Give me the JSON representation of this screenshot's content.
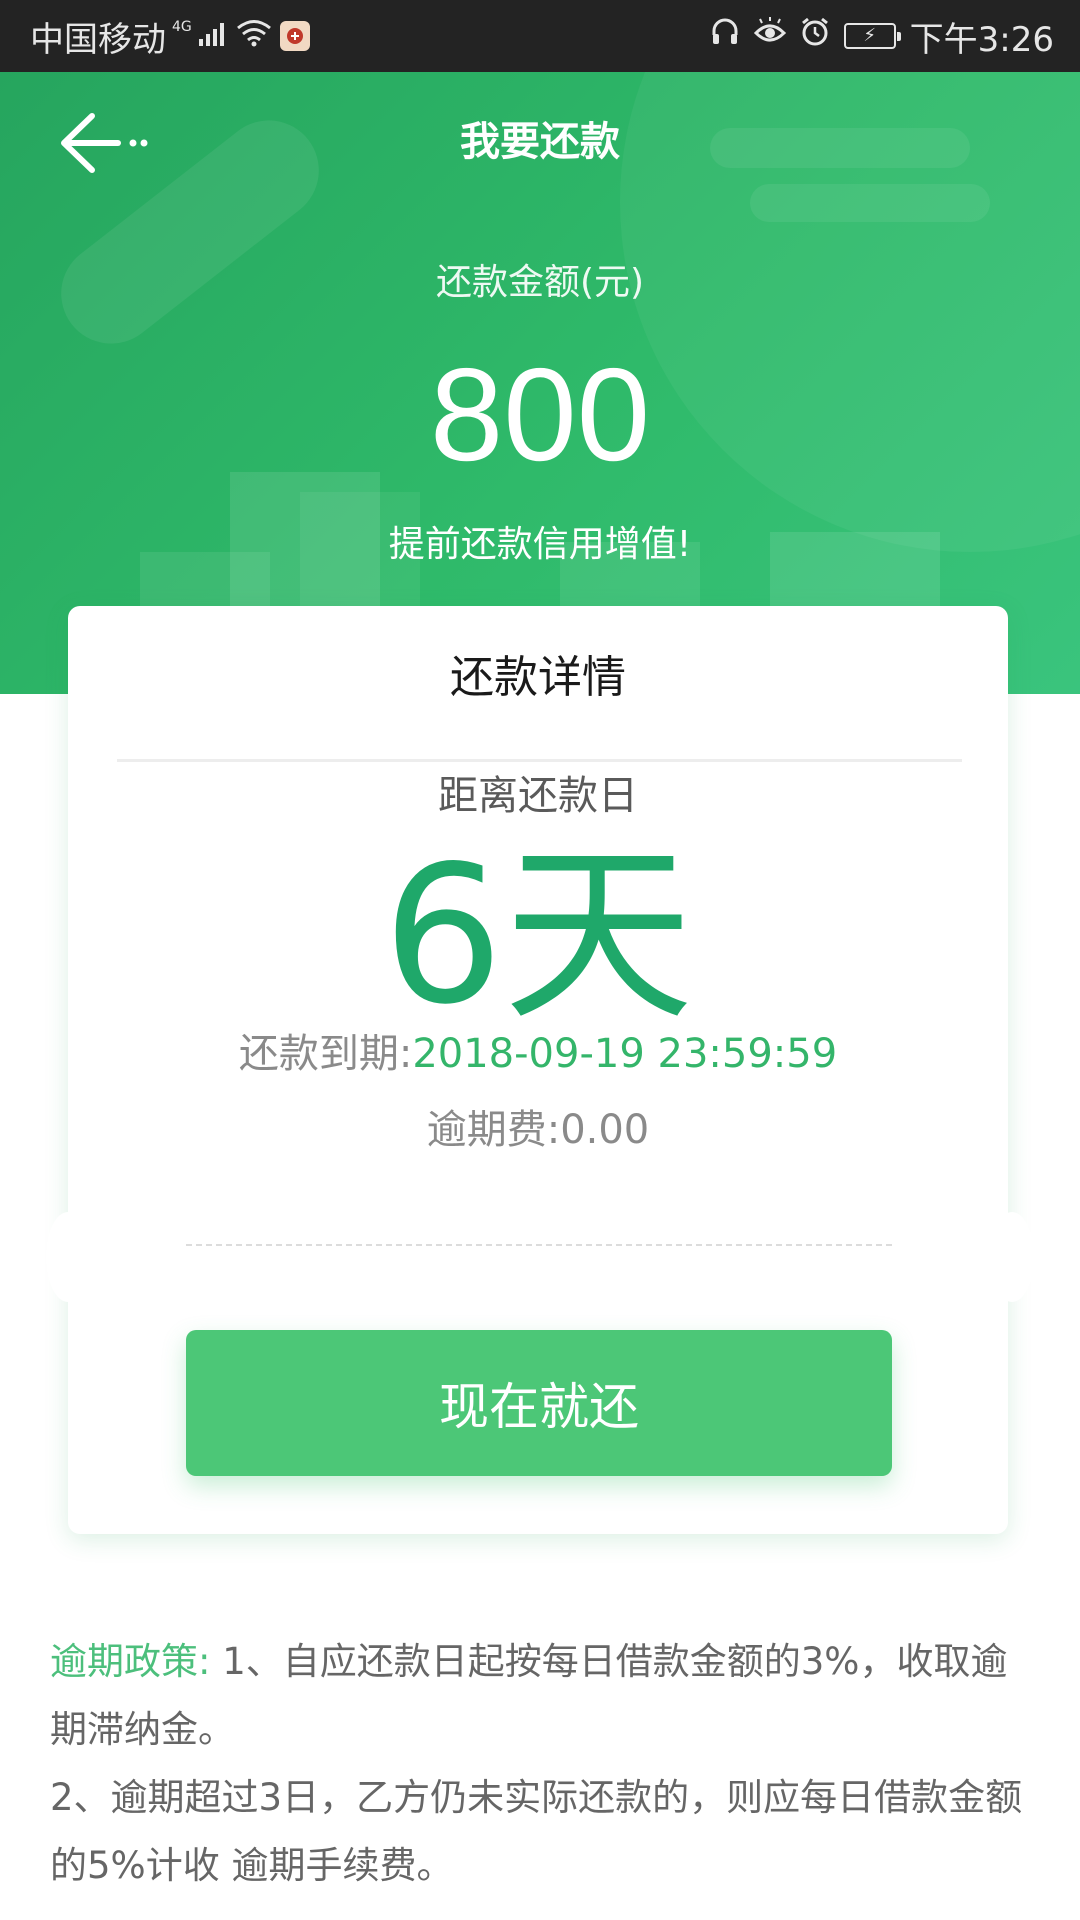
{
  "status_bar": {
    "carrier": "中国移动",
    "network": "4G",
    "time": "下午3:26"
  },
  "header": {
    "title": "我要还款",
    "amount_label": "还款金额(元)",
    "amount": "800",
    "slogan": "提前还款信用增值!"
  },
  "card": {
    "title": "还款详情",
    "days_label": "距离还款日",
    "days_value": "6天",
    "due_label": "还款到期:",
    "due_value": "2018-09-19 23:59:59",
    "fee_text": "逾期费:0.00",
    "pay_button": "现在就还"
  },
  "policy": {
    "label": "逾期政策:",
    "line1": " 1、自应还款日起按每日借款金额的3%，收取逾期滞纳金。",
    "line2": "2、逾期超过3日，乙方仍未实际还款的，则应每日借款金额的5%计收 逾期手续费。"
  },
  "colors": {
    "header_green": "#2fba6a",
    "accent_green": "#1fa86a",
    "button_green": "#4cc777"
  }
}
